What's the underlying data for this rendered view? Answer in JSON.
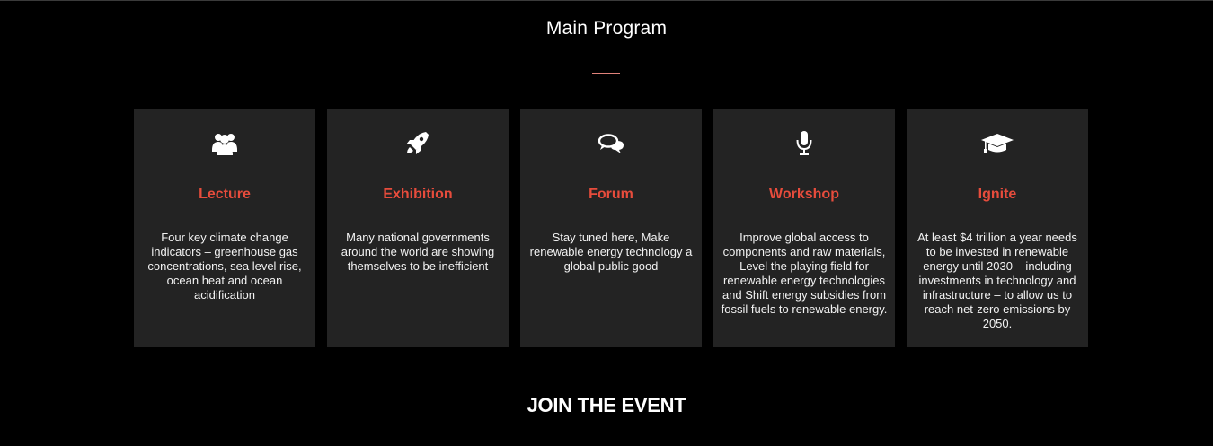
{
  "section": {
    "title": "Main Program",
    "divider_color": "#e0827a"
  },
  "cards": [
    {
      "icon": "users-icon",
      "title": "Lecture",
      "text": "Four key climate change indicators – greenhouse gas concentrations, sea level rise, ocean heat and ocean acidification"
    },
    {
      "icon": "rocket-icon",
      "title": "Exhibition",
      "text": "Many national governments around the world are showing themselves to be inefficient"
    },
    {
      "icon": "comments-icon",
      "title": "Forum",
      "text": "Stay tuned here, Make renewable energy technology a global public good"
    },
    {
      "icon": "microphone-icon",
      "title": "Workshop",
      "text": "Improve global access to components and raw materials, Level the playing field for renewable energy technologies and Shift energy subsidies from fossil fuels to renewable energy."
    },
    {
      "icon": "graduation-cap-icon",
      "title": "Ignite",
      "text": "At least $4 trillion a year needs to be invested in renewable energy until 2030 – including investments in technology and infrastructure – to allow us to reach net-zero emissions by 2050."
    }
  ],
  "join": {
    "title": "JOIN THE EVENT"
  },
  "colors": {
    "background": "#000000",
    "card_background": "#232323",
    "accent": "#e74c3c",
    "text": "#f2f2f2"
  }
}
